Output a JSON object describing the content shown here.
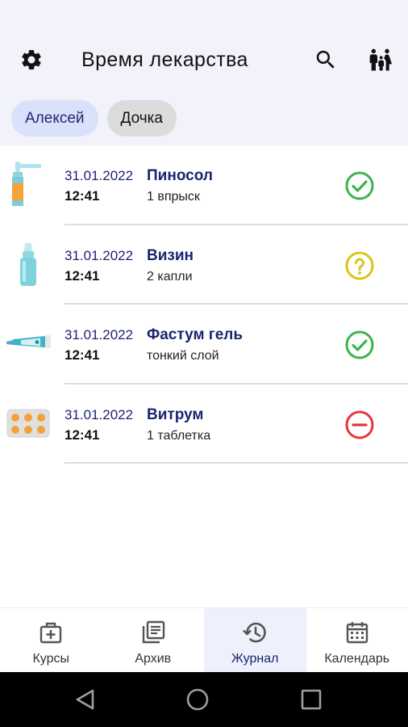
{
  "app": {
    "title": "Время лекарства"
  },
  "header": {
    "settings_icon": "gear-icon",
    "search_icon": "search-icon",
    "family_icon": "family-icon"
  },
  "profiles": [
    {
      "label": "Алексей",
      "selected": true
    },
    {
      "label": "Дочка",
      "selected": false
    }
  ],
  "entries": [
    {
      "date": "31.01.2022",
      "time": "12:41",
      "name": "Пиносол",
      "dose": "1 впрыск",
      "icon": "nasal-spray-icon",
      "status": "taken"
    },
    {
      "date": "31.01.2022",
      "time": "12:41",
      "name": "Визин",
      "dose": "2 капли",
      "icon": "eye-drops-icon",
      "status": "unknown"
    },
    {
      "date": "31.01.2022",
      "time": "12:41",
      "name": "Фастум гель",
      "dose": "тонкий слой",
      "icon": "ointment-tube-icon",
      "status": "taken"
    },
    {
      "date": "31.01.2022",
      "time": "12:41",
      "name": "Витрум",
      "dose": "1 таблетка",
      "icon": "pill-blister-icon",
      "status": "skipped"
    }
  ],
  "nav": [
    {
      "label": "Курсы",
      "icon": "medkit-icon",
      "active": false
    },
    {
      "label": "Архив",
      "icon": "archive-icon",
      "active": false
    },
    {
      "label": "Журнал",
      "icon": "history-icon",
      "active": true
    },
    {
      "label": "Календарь",
      "icon": "calendar-icon",
      "active": false
    }
  ],
  "colors": {
    "accent": "#1b2470",
    "header_bg": "#f2f2fb",
    "chip_active_bg": "#d9e1fb",
    "taken": "#3bb54a",
    "unknown": "#d8c51a",
    "skipped": "#e53935"
  }
}
